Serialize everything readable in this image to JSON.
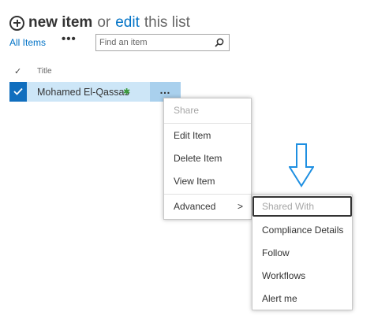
{
  "header": {
    "new_item": "new item",
    "or": "or",
    "edit": "edit",
    "this_list": "this list"
  },
  "views": {
    "all_items": "All Items",
    "more": "•••"
  },
  "search": {
    "placeholder": "Find an item"
  },
  "columns": {
    "check": "✓",
    "title": "Title"
  },
  "row": {
    "title": "Mohamed El-Qassas",
    "new_badge": "✱",
    "ellipsis": "…"
  },
  "menu": {
    "share": "Share",
    "items": [
      "Edit Item",
      "Delete Item",
      "View Item"
    ],
    "advanced": "Advanced",
    "advanced_chevron": ">"
  },
  "submenu": {
    "items": [
      "Shared With",
      "Compliance Details",
      "Follow",
      "Workflows",
      "Alert me"
    ]
  },
  "colors": {
    "link": "#0072c6",
    "row_selected": "#cde6f7",
    "check_box": "#106ebe",
    "arrow": "#1e8fe1"
  },
  "icons": {
    "add": "plus-circle-icon",
    "search": "magnifier-icon",
    "check": "checkmark-icon",
    "new": "new-badge-icon",
    "arrow": "down-arrow-icon"
  }
}
